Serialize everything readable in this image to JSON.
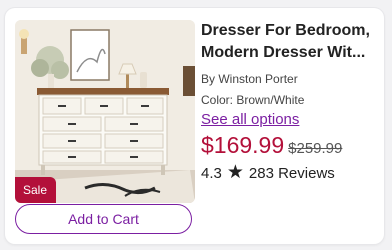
{
  "product": {
    "title_line1": "Dresser For Bedroom,",
    "title_line2": "Modern Dresser Wit...",
    "brand": "By Winston Porter",
    "color": "Color: Brown/White",
    "see_all": "See all options",
    "sale_price": "$169.99",
    "original_price": "$259.99",
    "rating": "4.3",
    "reviews": "283 Reviews",
    "badge": "Sale",
    "add_to_cart": "Add to Cart"
  },
  "icons": {
    "rating": "star-icon"
  },
  "colors": {
    "accent": "#7b1fa2",
    "sale": "#b3103a"
  }
}
